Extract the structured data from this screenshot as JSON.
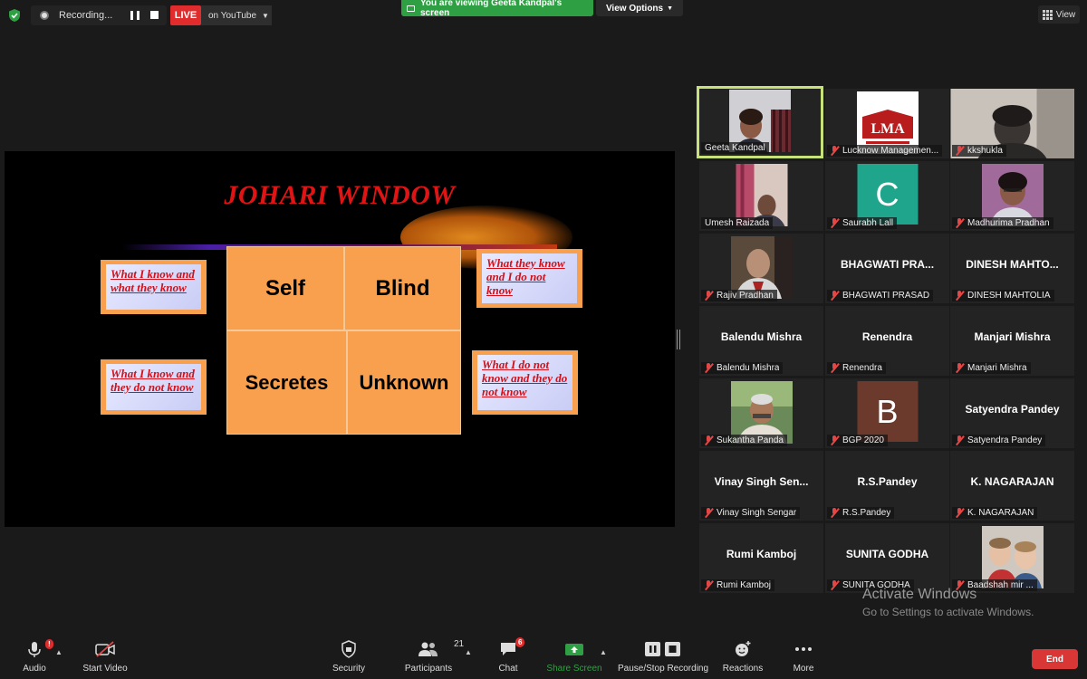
{
  "topbar": {
    "recording_label": "Recording...",
    "live_label": "LIVE",
    "live_target": "on YouTube",
    "viewing_text": "You are viewing Geeta Kandpal's screen",
    "view_options": "View Options",
    "view_label": "View"
  },
  "slide": {
    "title": "JOHARI WINDOW",
    "quadrants": {
      "self": "Self",
      "blind": "Blind",
      "secretes": "Secretes",
      "unknown": "Unknown"
    },
    "notes": {
      "top_left": "What I know and what they know",
      "top_right": "What they know and I do not know",
      "bottom_left": "What I know and they do not know",
      "bottom_right": "What I do not know and they do not know"
    }
  },
  "gallery": {
    "tiles": [
      {
        "name": "Geeta Kandpal"
      },
      {
        "name": "Lucknow Managemen..."
      },
      {
        "name": "kkshukla"
      },
      {
        "name": "Umesh Raizada"
      },
      {
        "name": "Saurabh Lall",
        "letter": "C"
      },
      {
        "name": "Madhurima Pradhan"
      },
      {
        "name": "Rajiv Pradhan"
      },
      {
        "name": "BHAGWATI PRASAD",
        "display": "BHAGWATI PRA..."
      },
      {
        "name": "DINESH MAHTOLIA",
        "display": "DINESH MAHTO..."
      },
      {
        "name": "Balendu Mishra",
        "display": "Balendu Mishra"
      },
      {
        "name": "Renendra",
        "display": "Renendra"
      },
      {
        "name": "Manjari Mishra",
        "display": "Manjari Mishra"
      },
      {
        "name": "Sukantha Panda"
      },
      {
        "name": "BGP 2020",
        "letter": "B"
      },
      {
        "name": "Satyendra Pandey",
        "display": "Satyendra Pandey"
      },
      {
        "name": "Vinay Singh Sengar",
        "display": "Vinay Singh Sen..."
      },
      {
        "name": "R.S.Pandey",
        "display": "R.S.Pandey"
      },
      {
        "name": "K. NAGARAJAN",
        "display": "K. NAGARAJAN"
      },
      {
        "name": "Rumi Kamboj",
        "display": "Rumi Kamboj"
      },
      {
        "name": "SUNITA GODHA",
        "display": "SUNITA GODHA"
      },
      {
        "name": "Baadshah mir ..."
      }
    ],
    "logo_text": "LMA",
    "colors": {
      "active_border": "#c8e27a",
      "letter_c_bg": "#1ea58c",
      "letter_b_bg": "#6b3a2c"
    }
  },
  "watermark": {
    "line1": "Activate Windows",
    "line2": "Go to Settings to activate Windows."
  },
  "toolbar": {
    "audio": "Audio",
    "audio_badge": "!",
    "start_video": "Start Video",
    "security": "Security",
    "participants": "Participants",
    "participants_count": "21",
    "chat": "Chat",
    "chat_badge": "6",
    "share_screen": "Share Screen",
    "recording": "Pause/Stop Recording",
    "reactions": "Reactions",
    "more": "More",
    "end": "End"
  }
}
